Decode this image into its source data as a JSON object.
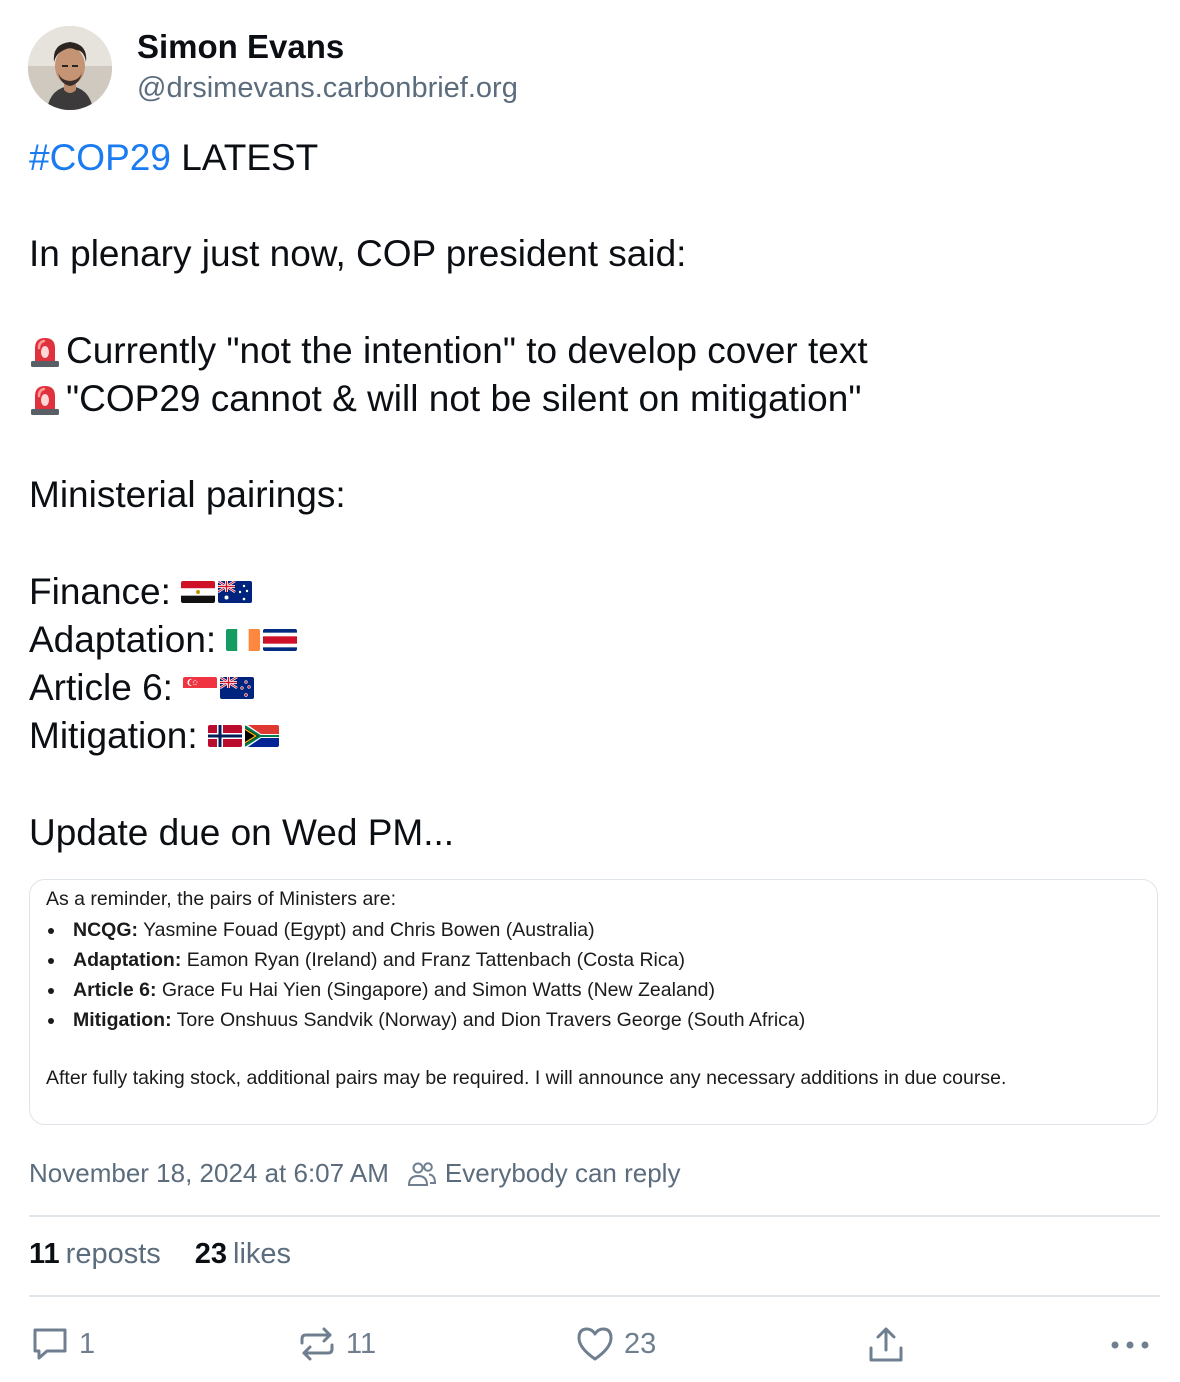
{
  "author": {
    "name": "Simon Evans",
    "handle": "@drsimevans.carbonbrief.org"
  },
  "post": {
    "hashtag": "#COP29",
    "headline_rest": " LATEST",
    "intro": "In plenary just now, COP president said:",
    "point1": "Currently \"not the intention\" to develop cover text",
    "point2": "\"COP29 cannot & will not be silent on mitigation\"",
    "pairings_heading": "Ministerial pairings:",
    "pairings": [
      {
        "label": "Finance:",
        "flags": [
          "egypt",
          "australia"
        ]
      },
      {
        "label": "Adaptation:",
        "flags": [
          "ireland",
          "costa-rica"
        ]
      },
      {
        "label": "Article 6:",
        "flags": [
          "singapore",
          "new-zealand"
        ]
      },
      {
        "label": "Mitigation:",
        "flags": [
          "norway",
          "south-africa"
        ]
      }
    ],
    "closing": "Update due on Wed PM..."
  },
  "embed": {
    "intro": "As a reminder, the pairs of Ministers are:",
    "items": [
      {
        "bold": "NCQG:",
        "text": " Yasmine Fouad (Egypt) and Chris Bowen (Australia)"
      },
      {
        "bold": "Adaptation:",
        "text": " Eamon Ryan (Ireland) and Franz Tattenbach (Costa Rica)"
      },
      {
        "bold": "Article 6:",
        "text": " Grace Fu Hai Yien (Singapore) and Simon Watts (New Zealand)"
      },
      {
        "bold": "Mitigation:",
        "text": " Tore Onshuus Sandvik (Norway) and Dion Travers George (South Africa)"
      }
    ],
    "note": "After fully taking stock, additional pairs may be required. I will announce any necessary additions in due course."
  },
  "meta": {
    "timestamp": "November 18, 2024 at 6:07 AM",
    "reply_setting": "Everybody can reply"
  },
  "stats": {
    "reposts_count": "11",
    "reposts_label": "reposts",
    "likes_count": "23",
    "likes_label": "likes"
  },
  "actions": {
    "reply_count": "1",
    "repost_count": "11",
    "like_count": "23"
  },
  "colors": {
    "hashtag": "#1a7cf0",
    "secondary_text": "#5b6c7d",
    "divider": "#e1e6eb"
  },
  "icons": [
    "siren-icon",
    "people-icon",
    "reply-icon",
    "repost-icon",
    "heart-icon",
    "share-icon",
    "more-icon"
  ]
}
